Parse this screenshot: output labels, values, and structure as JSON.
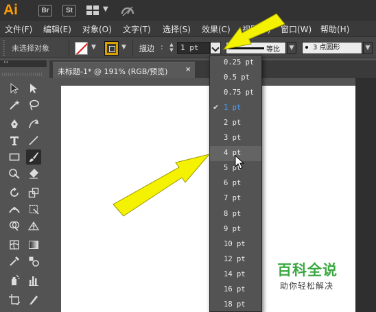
{
  "app": {
    "logo": "Ai",
    "bridge_label": "Br",
    "stock_label": "St",
    "colors": {
      "logo": "#ff9a00",
      "selected_item": "#4aa0ff",
      "annotation_arrow": "#f4f200"
    }
  },
  "menu": {
    "items": [
      "文件(F)",
      "编辑(E)",
      "对象(O)",
      "文字(T)",
      "选择(S)",
      "效果(C)",
      "视图(V)",
      "窗口(W)",
      "帮助(H)"
    ]
  },
  "control_bar": {
    "selection_status": "未选择对象",
    "stroke_label": "描边",
    "stroke_colon": ":",
    "stroke_weight": "1 pt",
    "profile_label": "等比",
    "brush_label": "3 点圆形"
  },
  "tools_panel": {
    "collapse_label": "‹‹"
  },
  "document": {
    "tab_title": "未标题-1* @ 191% (RGB/预览)",
    "close_glyph": "×"
  },
  "stroke_dropdown": {
    "selected": "1 pt",
    "hovered": "4 pt",
    "check_glyph": "✔",
    "options": [
      "0.25 pt",
      "0.5 pt",
      "0.75 pt",
      "1 pt",
      "2 pt",
      "3 pt",
      "4 pt",
      "5 pt",
      "6 pt",
      "7 pt",
      "8 pt",
      "9 pt",
      "10 pt",
      "12 pt",
      "14 pt",
      "16 pt",
      "18 pt"
    ]
  },
  "watermark": {
    "title": "百科全说",
    "subtitle": "助你轻松解决"
  }
}
